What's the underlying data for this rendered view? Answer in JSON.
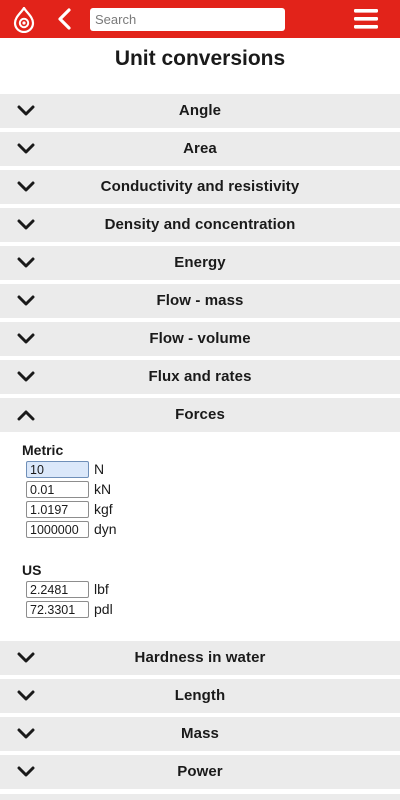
{
  "search": {
    "placeholder": "Search",
    "value": ""
  },
  "page": {
    "title": "Unit conversions"
  },
  "colors": {
    "brand": "#e2231a",
    "row_bg": "#ebebeb",
    "active_input": "#dbe8fa"
  },
  "icons": {
    "logo": "water-drop-logo-icon",
    "back": "chevron-left-icon",
    "menu": "hamburger-menu-icon",
    "collapsed": "chevron-down-icon",
    "expanded": "chevron-up-icon"
  },
  "categories_before": [
    {
      "label": "Angle"
    },
    {
      "label": "Area"
    },
    {
      "label": "Conductivity and resistivity"
    },
    {
      "label": "Density and concentration"
    },
    {
      "label": "Energy"
    },
    {
      "label": "Flow - mass"
    },
    {
      "label": "Flow - volume"
    },
    {
      "label": "Flux and rates"
    }
  ],
  "expanded": {
    "label": "Forces",
    "groups": [
      {
        "name": "Metric",
        "units": [
          {
            "value": "10",
            "unit": "N"
          },
          {
            "value": "0.01",
            "unit": "kN"
          },
          {
            "value": "1.0197",
            "unit": "kgf"
          },
          {
            "value": "1000000",
            "unit": "dyn"
          }
        ]
      },
      {
        "name": "US",
        "units": [
          {
            "value": "2.2481",
            "unit": "lbf"
          },
          {
            "value": "72.3301",
            "unit": "pdl"
          }
        ]
      }
    ]
  },
  "categories_after": [
    {
      "label": "Hardness in water"
    },
    {
      "label": "Length"
    },
    {
      "label": "Mass"
    },
    {
      "label": "Power"
    }
  ]
}
